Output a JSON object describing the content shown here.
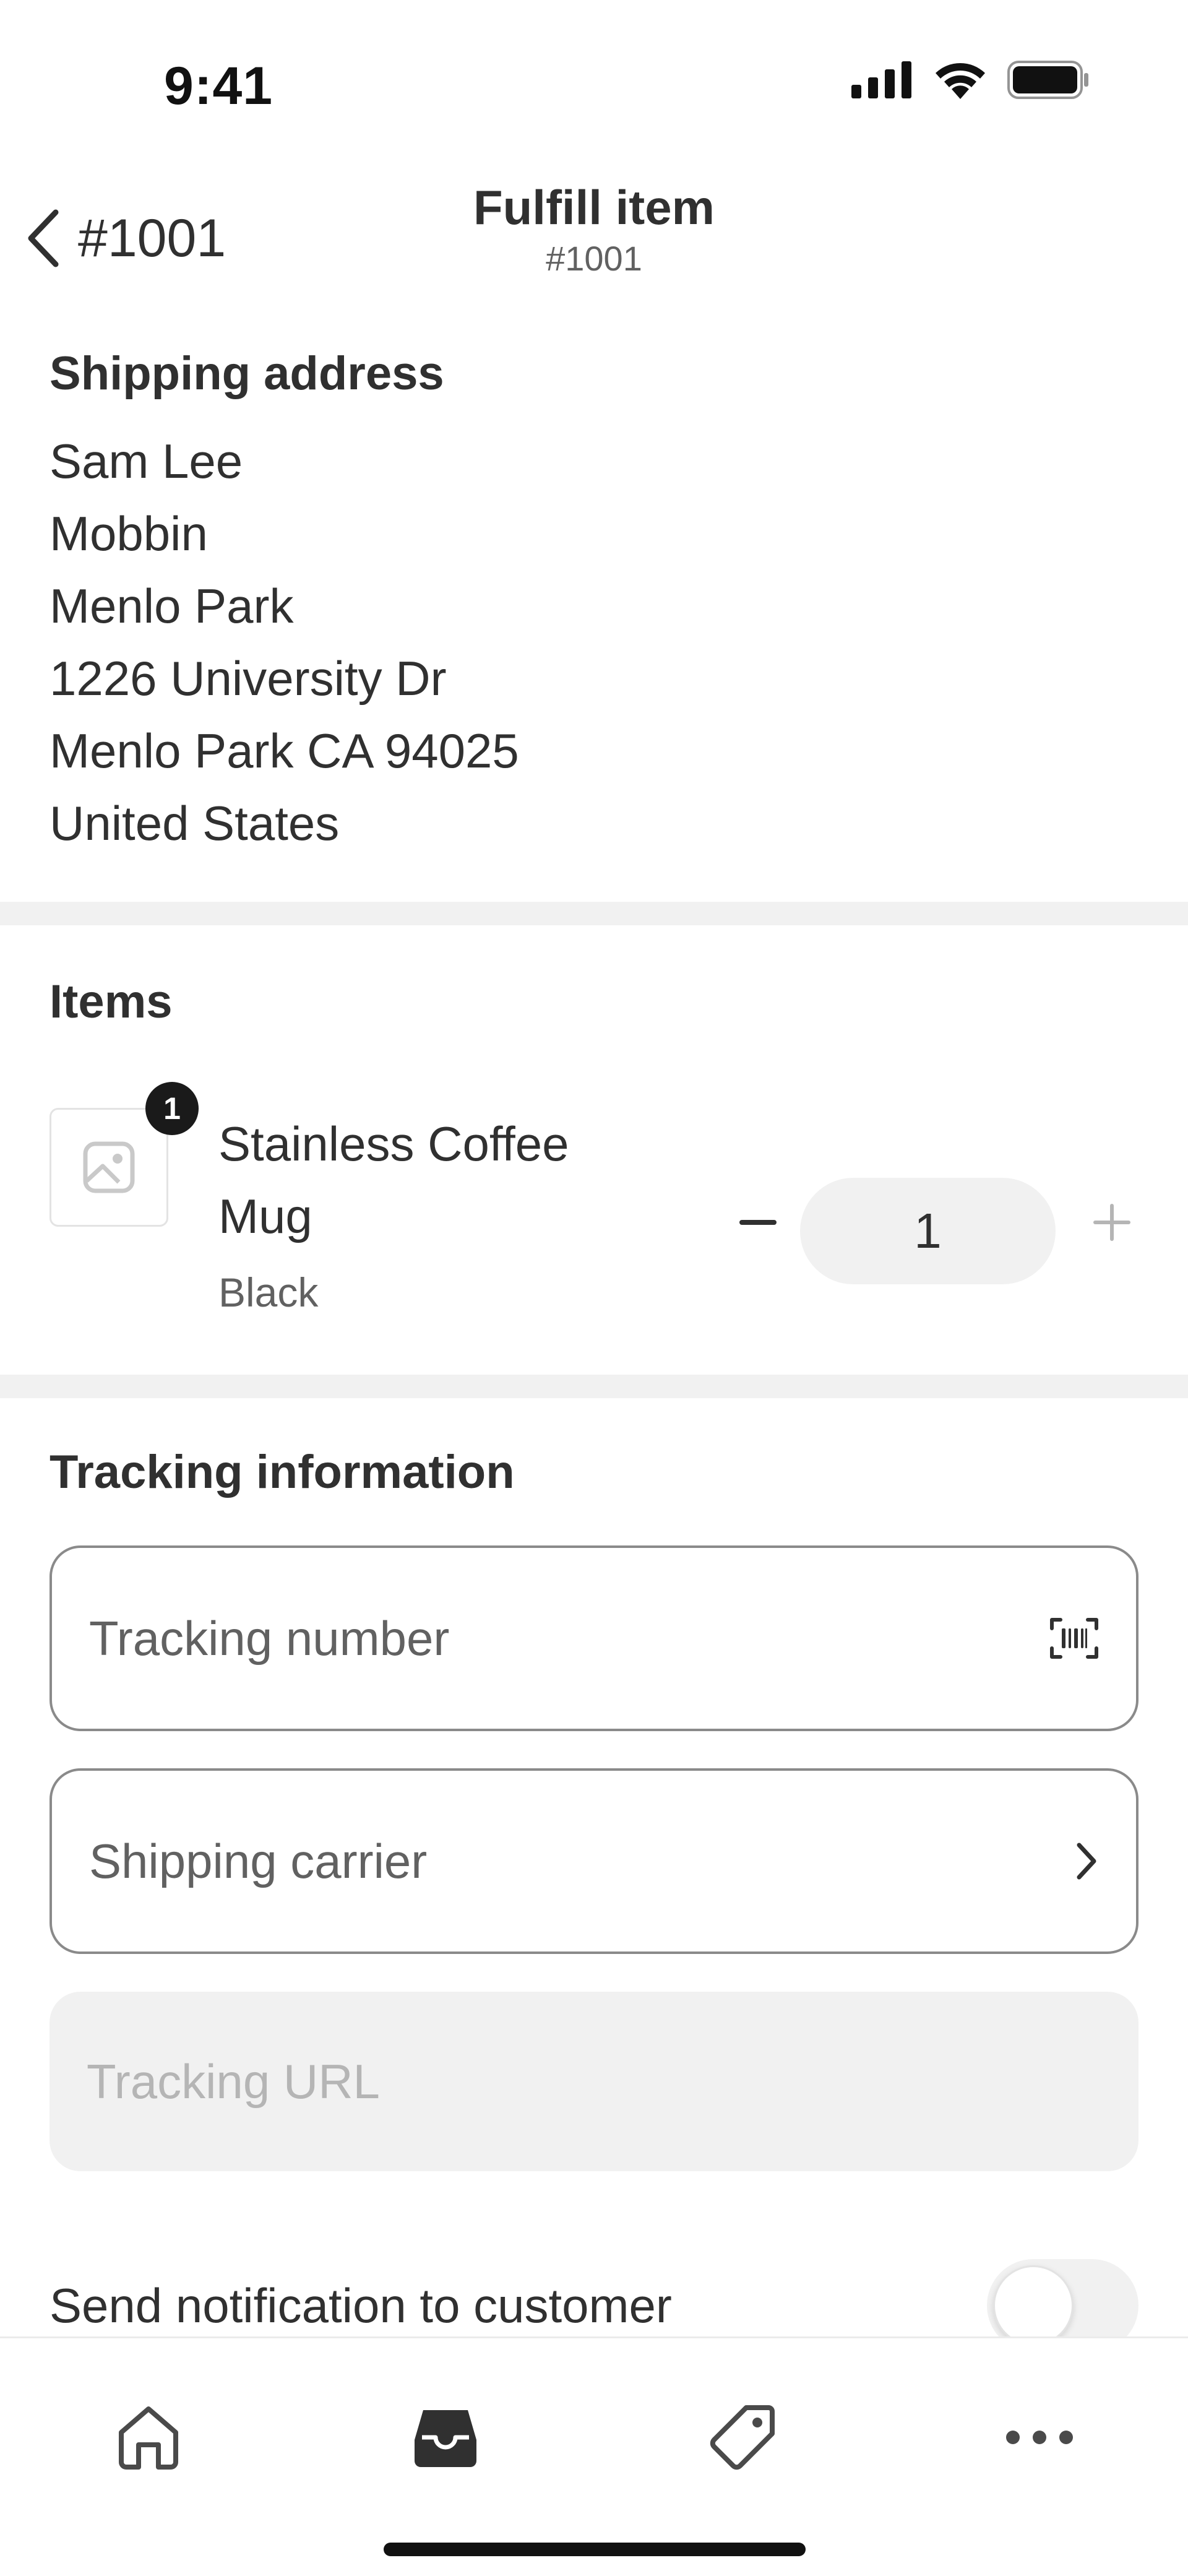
{
  "status_bar": {
    "time": "9:41",
    "icons": [
      "cellular-signal-icon",
      "wifi-icon",
      "battery-icon"
    ]
  },
  "nav": {
    "back_label": "#1001",
    "title": "Fulfill item",
    "subtitle": "#1001"
  },
  "shipping_address": {
    "heading": "Shipping address",
    "lines": [
      "Sam Lee",
      "Mobbin",
      "Menlo Park",
      "1226 University Dr",
      "Menlo Park CA 94025",
      "United States"
    ]
  },
  "items": {
    "heading": "Items",
    "list": [
      {
        "badge": "1",
        "title": "Stainless Coffee Mug",
        "variant": "Black",
        "quantity": "1"
      }
    ]
  },
  "tracking": {
    "heading": "Tracking information",
    "tracking_number_placeholder": "Tracking number",
    "shipping_carrier_placeholder": "Shipping carrier",
    "tracking_url_placeholder": "Tracking URL"
  },
  "notification": {
    "label": "Send notification to customer",
    "enabled": false
  },
  "tab_bar": {
    "tabs": [
      "home-icon",
      "orders-inbox-icon",
      "products-tag-icon",
      "more-icon"
    ],
    "active": "orders-inbox-icon"
  },
  "colors": {
    "text_primary": "#303030",
    "text_secondary": "#616161",
    "placeholder_disabled": "#b5b5b5",
    "divider": "#f1f1f1",
    "border": "#8a8a8a"
  }
}
